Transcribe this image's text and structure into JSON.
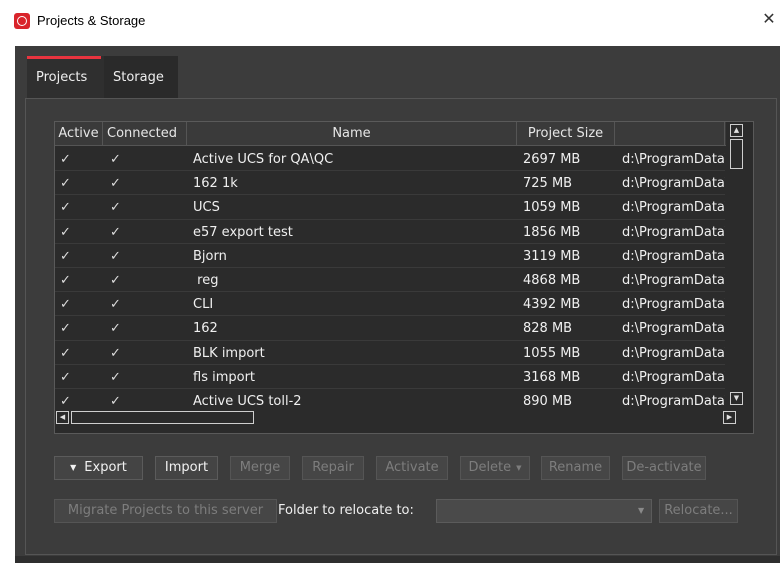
{
  "window": {
    "title": "Projects & Storage",
    "close_glyph": "✕"
  },
  "tabs": [
    {
      "label": "Projects",
      "selected": true
    },
    {
      "label": "Storage",
      "selected": false
    }
  ],
  "table": {
    "columns": [
      "Active",
      "Connected",
      "Name",
      "Project Size",
      ""
    ],
    "check_glyph": "✓",
    "rows": [
      {
        "active": true,
        "connected": true,
        "name": "Active UCS for QA\\QC",
        "size": "2697 MB",
        "path": "d:\\ProgramData\\"
      },
      {
        "active": true,
        "connected": true,
        "name": "162 1k",
        "size": "725 MB",
        "path": "d:\\ProgramData\\"
      },
      {
        "active": true,
        "connected": true,
        "name": "UCS",
        "size": "1059 MB",
        "path": "d:\\ProgramData\\"
      },
      {
        "active": true,
        "connected": true,
        "name": "e57 export test",
        "size": "1856 MB",
        "path": "d:\\ProgramData\\"
      },
      {
        "active": true,
        "connected": true,
        "name": "Bjorn",
        "size": "3119 MB",
        "path": "d:\\ProgramData\\"
      },
      {
        "active": true,
        "connected": true,
        "name": " reg",
        "size": "4868 MB",
        "path": "d:\\ProgramData\\"
      },
      {
        "active": true,
        "connected": true,
        "name": "CLI",
        "size": "4392 MB",
        "path": "d:\\ProgramData\\"
      },
      {
        "active": true,
        "connected": true,
        "name": "162",
        "size": "828 MB",
        "path": "d:\\ProgramData\\"
      },
      {
        "active": true,
        "connected": true,
        "name": "BLK import",
        "size": "1055 MB",
        "path": "d:\\ProgramData\\"
      },
      {
        "active": true,
        "connected": true,
        "name": "fls import",
        "size": "3168 MB",
        "path": "d:\\ProgramData\\"
      },
      {
        "active": true,
        "connected": true,
        "name": "Active UCS toll-2",
        "size": "890 MB",
        "path": "d:\\ProgramData\\"
      }
    ]
  },
  "scrollbar_glyphs": {
    "up": "▲",
    "down": "▼",
    "left": "◀",
    "right": "▶"
  },
  "buttons": {
    "export": "Export",
    "import": "Import",
    "merge": "Merge",
    "repair": "Repair",
    "activate": "Activate",
    "delete": "Delete",
    "rename": "Rename",
    "deactivate": "De-activate",
    "migrate": "Migrate Projects to this server",
    "relocate": "Relocate..."
  },
  "relocate": {
    "label": "Folder to relocate to:",
    "selected_value": ""
  },
  "colors": {
    "accent": "#e8343f",
    "app_icon": "#d9242b",
    "background": "#3c3c3c",
    "grid_background": "#2b2b2b"
  }
}
